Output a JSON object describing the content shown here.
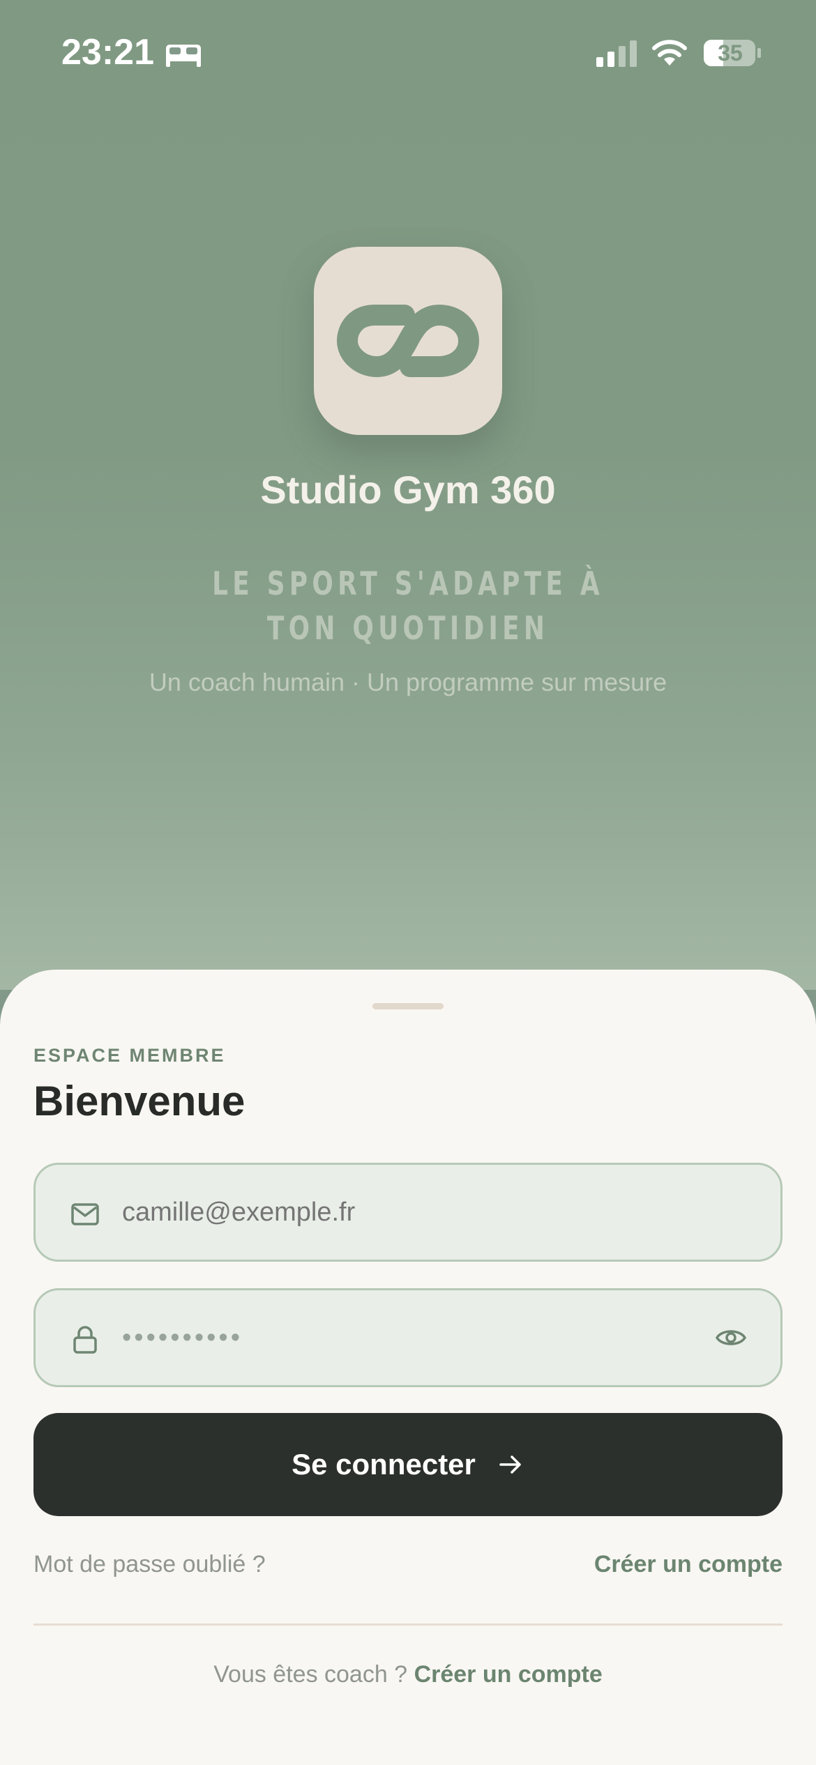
{
  "status_bar": {
    "time": "23:21",
    "battery": "35",
    "icons": [
      "bed-icon",
      "signal-icon",
      "wifi-icon",
      "battery-icon"
    ]
  },
  "hero": {
    "logo_icon": "infinity-logo-icon",
    "app_name": "Studio Gym 360",
    "tagline_line1": "LE SPORT S'ADAPTE À",
    "tagline_line2": "TON QUOTIDIEN",
    "subtitle": "Un coach humain · Un programme sur mesure"
  },
  "sheet": {
    "section_label": "ESPACE MEMBRE",
    "title": "Bienvenue",
    "email_placeholder": "camille@exemple.fr",
    "email_icon": "mail-icon",
    "password_value": "••••••••••",
    "password_icon": "lock-icon",
    "password_toggle_icon": "eye-icon",
    "login_label": "Se connecter",
    "login_icon": "arrow-right-icon",
    "forgot_password": "Mot de passe oublié ?",
    "create_account": "Créer un compte",
    "coach_prompt": "Vous êtes coach ?",
    "coach_create_account": "Créer un compte"
  },
  "colors": {
    "hero_green": "#809983",
    "logo_bg": "#e6ddd2",
    "sheet_bg": "#f9f7f3",
    "button_dark": "#2c302c",
    "accent_green": "#6b8570",
    "field_bg": "#e9efe8",
    "field_border": "#b6c9b7"
  }
}
